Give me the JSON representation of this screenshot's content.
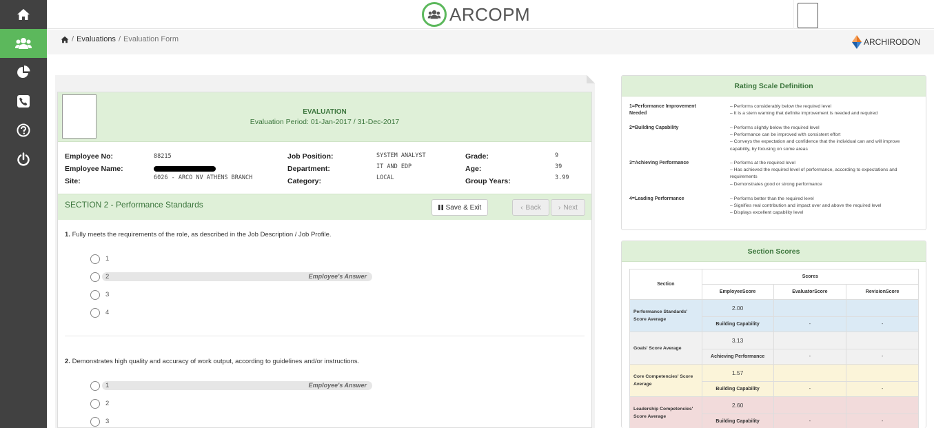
{
  "app": {
    "logo_text": "ARCOPM",
    "brand": "ARCHIRODON"
  },
  "sidebar": {
    "items": [
      {
        "icon": "home-icon",
        "active": false
      },
      {
        "icon": "users-icon",
        "active": true
      },
      {
        "icon": "pie-chart-icon",
        "active": false
      },
      {
        "icon": "phone-icon",
        "active": false
      },
      {
        "icon": "help-icon",
        "active": false
      },
      {
        "icon": "power-icon",
        "active": false
      }
    ]
  },
  "breadcrumb": {
    "sep1": "/",
    "evaluations": "Evaluations",
    "sep2": "/",
    "current": "Evaluation Form"
  },
  "form": {
    "title": "EVALUATION",
    "period": "Evaluation Period: 01-Jan-2017 / 31-Dec-2017",
    "employee": {
      "no_label": "Employee No:",
      "no": "88215",
      "name_label": "Employee Name:",
      "site_label": "Site:",
      "site": "6026 - ARCO NV ATHENS BRANCH",
      "position_label": "Job Position:",
      "position": "SYSTEM ANALYST",
      "department_label": "Department:",
      "department": "IT AND EDP",
      "category_label": "Category:",
      "category": "LOCAL",
      "grade_label": "Grade:",
      "grade": "9",
      "age_label": "Age:",
      "age": "39",
      "years_label": "Group Years:",
      "years": "3.99"
    },
    "section_title": "SECTION 2 - Performance Standards",
    "buttons": {
      "save_exit": "Save & Exit",
      "back": "Back",
      "next": "Next"
    },
    "questions": [
      {
        "num": "1.",
        "text": "Fully meets the requirements of the role, as described in the Job Description / Job Profile.",
        "options": [
          "1",
          "2",
          "3",
          "4"
        ],
        "answer_index": 1,
        "answer_label": "Employee's Answer"
      },
      {
        "num": "2.",
        "text": "Demonstrates high quality and accuracy of work output, according to guidelines and/or instructions.",
        "options": [
          "1",
          "2",
          "3"
        ],
        "answer_index": 0,
        "answer_label": "Employee's Answer"
      }
    ]
  },
  "rating_scale": {
    "title": "Rating Scale Definition",
    "items": [
      {
        "label": "1=Performance Improvement Needed",
        "lines": [
          "– Performs considerably below the required level",
          "– It is a stern warning that definite improvement is needed and required"
        ]
      },
      {
        "label": "2=Building Capability",
        "lines": [
          "– Performs slightly below the required level",
          "– Performance can be improved with consistent effort",
          "– Conveys the expectation and confidence that the individual can and will improve capability, by focusing on some areas"
        ]
      },
      {
        "label": "3=Achieving Performance",
        "lines": [
          "– Performs at the required level",
          "– Has achieved the required level of performance, according to expectations and requirements",
          "– Demonstrates good or strong performance"
        ]
      },
      {
        "label": "4=Leading Performance",
        "lines": [
          "– Performs better than the required level",
          "– Signifies real contribution and impact over and above the required level",
          "– Displays excellent capability level"
        ]
      }
    ]
  },
  "section_scores": {
    "title": "Section Scores",
    "headers": {
      "section": "Section",
      "scores": "Scores",
      "employee": "EmployeeScore",
      "evaluator": "EvaluatorScore",
      "revision": "RevisionScore"
    },
    "rows": [
      {
        "name": "Performance Standards' Score Average",
        "employee_score": "2.00",
        "employee_rating": "Building Capability",
        "evaluator": "-",
        "revision": "-",
        "color": "#dbeaf5"
      },
      {
        "name": "Goals' Score Average",
        "employee_score": "3.13",
        "employee_rating": "Achieving Performance",
        "evaluator": "-",
        "revision": "-",
        "color": "#f1f1f1"
      },
      {
        "name": "Core Competencies' Score Average",
        "employee_score": "1.57",
        "employee_rating": "Building Capability",
        "evaluator": "-",
        "revision": "-",
        "color": "#fbf4d9"
      },
      {
        "name": "Leadership Competencies' Score Average",
        "employee_score": "2.60",
        "employee_rating": "Building Capability",
        "evaluator": "-",
        "revision": "-",
        "color": "#f2dbdb"
      }
    ]
  }
}
